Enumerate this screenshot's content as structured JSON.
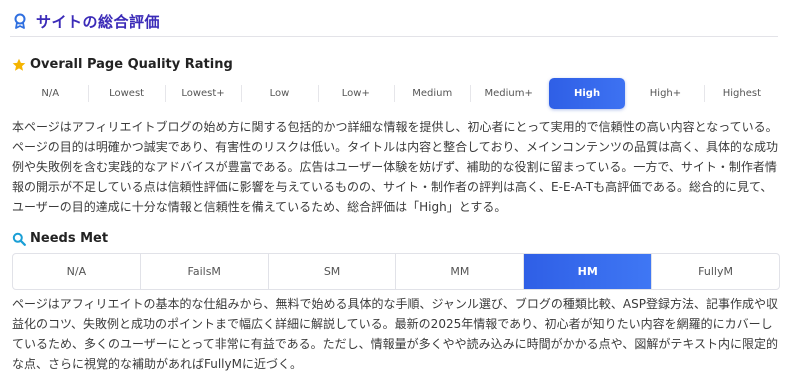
{
  "header": {
    "title": "サイトの総合評価",
    "icon": "award-ribbon-icon"
  },
  "quality": {
    "title": "Overall Page Quality Rating",
    "icon": "star-icon",
    "options": [
      "N/A",
      "Lowest",
      "Lowest+",
      "Low",
      "Low+",
      "Medium",
      "Medium+",
      "High",
      "High+",
      "Highest"
    ],
    "selected": "High",
    "description": "本ページはアフィリエイトブログの始め方に関する包括的かつ詳細な情報を提供し、初心者にとって実用的で信頼性の高い内容となっている。ページの目的は明確かつ誠実であり、有害性のリスクは低い。タイトルは内容と整合しており、メインコンテンツの品質は高く、具体的な成功例や失敗例を含む実践的なアドバイスが豊富である。広告はユーザー体験を妨げず、補助的な役割に留まっている。一方で、サイト・制作者情報の開示が不足している点は信頼性評価に影響を与えているものの、サイト・制作者の評判は高く、E-E-A-Tも高評価である。総合的に見て、ユーザーの目的達成に十分な情報と信頼性を備えているため、総合評価は「High」とする。"
  },
  "needs_met": {
    "title": "Needs Met",
    "icon": "magnifier-icon",
    "options": [
      "N/A",
      "FailsM",
      "SM",
      "MM",
      "HM",
      "FullyM"
    ],
    "selected": "HM",
    "description": "ページはアフィリエイトの基本的な仕組みから、無料で始める具体的な手順、ジャンル選び、ブログの種類比較、ASP登録方法、記事作成や収益化のコツ、失敗例と成功のポイントまで幅広く詳細に解説している。最新の2025年情報であり、初心者が知りたい内容を網羅的にカバーしているため、多くのユーザーにとって非常に有益である。ただし、情報量が多くやや読み込みに時間がかかる点や、図解がテキスト内に限定的な点、さらに視覚的な補助があればFullyMに近づく。"
  },
  "colors": {
    "accent": "#3366ee",
    "title": "#3b2bb8",
    "star": "#f5b400",
    "search": "#1a9fd6"
  }
}
